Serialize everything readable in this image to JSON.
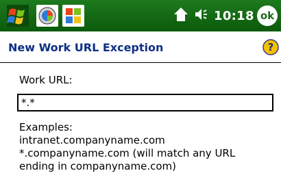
{
  "status_bar": {
    "start_icon": "windows-flag-icon",
    "app_icons": [
      "circle-app-icon",
      "windows-flag-app-icon"
    ],
    "tray_icons": [
      "connectivity-icon",
      "volume-icon"
    ],
    "clock": "10:18",
    "ok_label": "ok"
  },
  "header": {
    "title": "New Work URL Exception",
    "help_icon": "help-icon"
  },
  "form": {
    "url_label": "Work URL:",
    "url_value": "*.*",
    "examples_heading": "Examples:",
    "example_lines": [
      "intranet.companyname.com",
      "*.companyname.com (will match any URL",
      "ending in companyname.com)"
    ]
  },
  "colors": {
    "titlebar": "#1d7a1d",
    "header_text": "#0d2f84",
    "help_yellow": "#f2c200"
  }
}
